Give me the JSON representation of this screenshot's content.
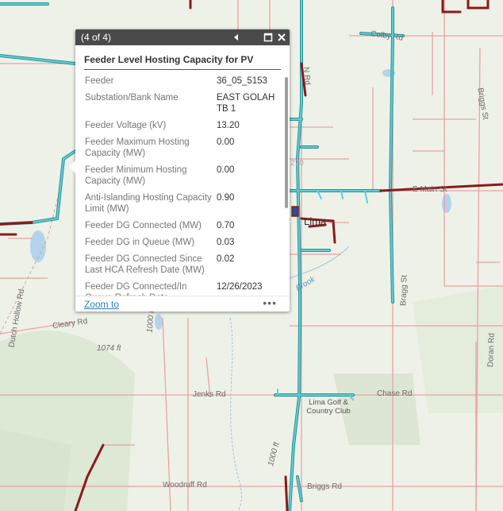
{
  "popup": {
    "count": "(4 of 4)",
    "title": "Feeder Level Hosting Capacity for PV",
    "fields": [
      {
        "label": "Feeder",
        "value": "36_05_5153"
      },
      {
        "label": "Substation/Bank Name",
        "value": "EAST GOLAH TB 1"
      },
      {
        "label": "Feeder Voltage (kV)",
        "value": "13.20"
      },
      {
        "label": "Feeder Maximum Hosting Capacity (MW)",
        "value": "0.00"
      },
      {
        "label": "Feeder Minimum Hosting Capacity (MW)",
        "value": "0.00"
      },
      {
        "label": "Anti-Islanding Hosting Capacity Limit (MW)",
        "value": "0.90"
      },
      {
        "label": "Feeder DG Connected (MW)",
        "value": "0.70"
      },
      {
        "label": "Feeder DG in Queue (MW)",
        "value": "0.03"
      },
      {
        "label": "Feeder DG Connected Since Last HCA Refresh Date (MW)",
        "value": "0.02"
      },
      {
        "label": "Feeder DG Connected/In Queue Refresh Date",
        "value": "12/26/2023"
      }
    ],
    "zoom_label": "Zoom to",
    "more_label": "•••",
    "icons": {
      "previous": "triangle-left-icon",
      "maximize": "maximize-icon",
      "close": "close-icon"
    }
  },
  "map": {
    "labels": {
      "colby_rd": "Colby Rd",
      "e_main_st": "E Main St",
      "briggs_st": "Briggs St",
      "lima": "Lima",
      "brook": "Brook",
      "dutch_hollow_rd": "Dutch Hollow Rd",
      "cleary_rd": "Cleary Rd",
      "elev_1074": "1074 ft",
      "elev_1000a": "1000 ft",
      "elev_1000b": "1000 ft",
      "jenks_rd": "Jenks Rd",
      "chase_rd": "Chase Rd",
      "lima_golf": "Lima Golf & Country Club",
      "woodruff_rd": "Woodruff Rd",
      "briggs_rd": "Briggs Rd",
      "bragg_st": "Bragg St",
      "doran_rd": "Doran Rd",
      "n_rd": "N Rd",
      "rd_270": "270"
    }
  },
  "colors": {
    "feeder_cyan": "#3fb8be",
    "feeder_red": "#8b1a1a",
    "road": "#e8a2a2",
    "water": "#b5d3ea",
    "popup_header": "#4a4a4a",
    "link": "#2d7dbd"
  }
}
